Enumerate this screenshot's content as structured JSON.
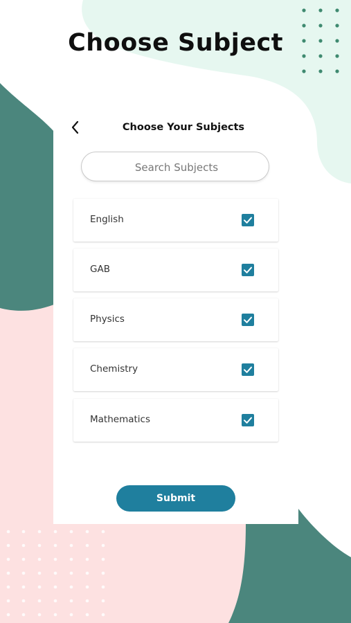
{
  "page": {
    "title": "Choose Subject"
  },
  "card": {
    "title": "Choose Your Subjects"
  },
  "search": {
    "placeholder": "Search Subjects"
  },
  "subjects": [
    {
      "label": "English",
      "checked": true
    },
    {
      "label": "GAB",
      "checked": true
    },
    {
      "label": "Physics",
      "checked": true
    },
    {
      "label": "Chemistry",
      "checked": true
    },
    {
      "label": "Mathematics",
      "checked": true
    }
  ],
  "submit": {
    "label": "Submit"
  },
  "colors": {
    "accent": "#1f7f9e",
    "teal_blob": "#4b867d",
    "mint_blob": "#e6f7f0",
    "pink_blob": "#fde1e1"
  },
  "icons": {
    "back": "chevron-left-icon",
    "check": "checkbox-checked-icon"
  }
}
